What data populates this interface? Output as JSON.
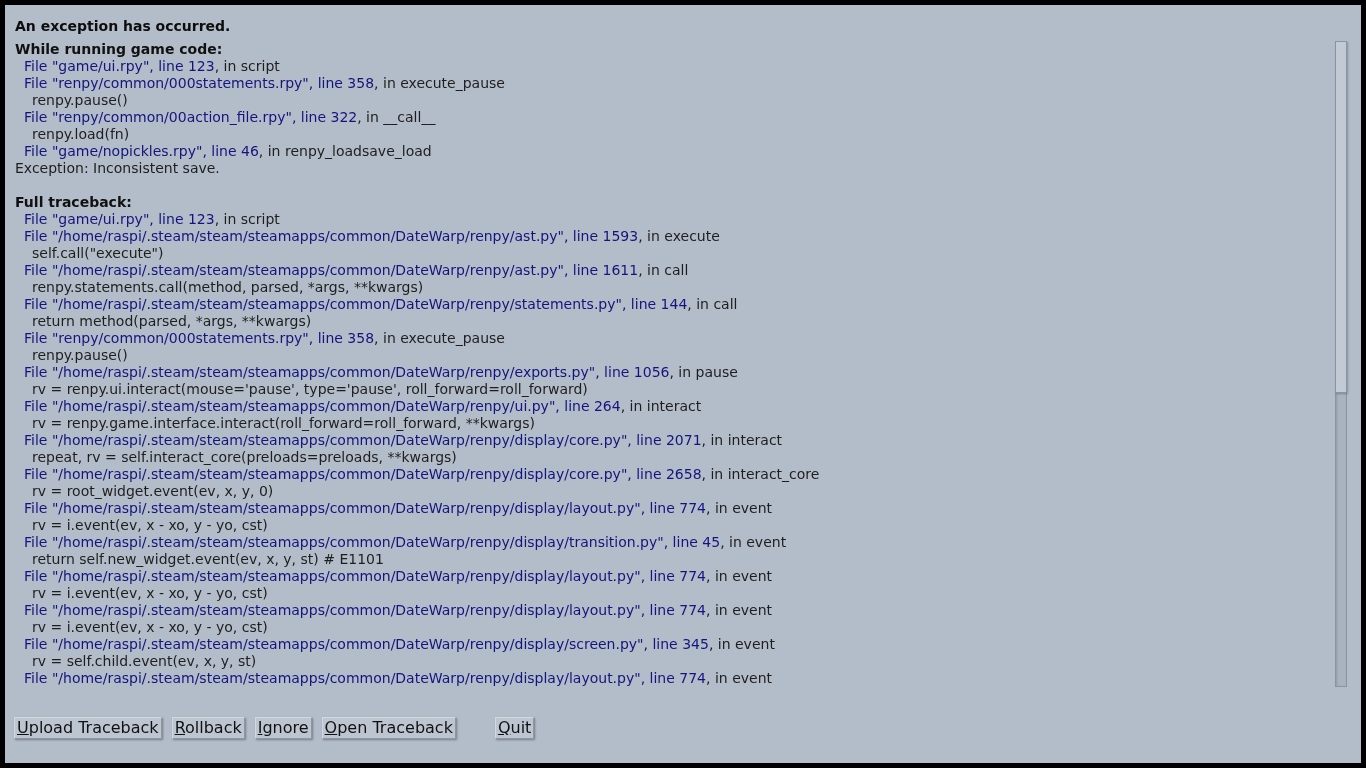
{
  "title": "An exception has occurred.",
  "sections": [
    {
      "heading": "While running game code:",
      "entries": [
        {
          "kind": "frame",
          "link": "File \"game/ui.rpy\", line 123",
          "detail": ", in script"
        },
        {
          "kind": "frame",
          "link": "File \"renpy/common/000statements.rpy\", line 358",
          "detail": ", in execute_pause"
        },
        {
          "kind": "code",
          "text": "renpy.pause()"
        },
        {
          "kind": "frame",
          "link": "File \"renpy/common/00action_file.rpy\", line 322",
          "detail": ", in __call__"
        },
        {
          "kind": "code",
          "text": "renpy.load(fn)"
        },
        {
          "kind": "frame",
          "link": "File \"game/nopickles.rpy\", line 46",
          "detail": ", in renpy_loadsave_load"
        },
        {
          "kind": "message",
          "text": "Exception: Inconsistent save."
        }
      ]
    },
    {
      "heading": "Full traceback:",
      "entries": [
        {
          "kind": "frame",
          "link": "File \"game/ui.rpy\", line 123",
          "detail": ", in script"
        },
        {
          "kind": "frame",
          "link": "File \"/home/raspi/.steam/steam/steamapps/common/DateWarp/renpy/ast.py\", line 1593",
          "detail": ", in execute"
        },
        {
          "kind": "code",
          "text": "self.call(\"execute\")"
        },
        {
          "kind": "frame",
          "link": "File \"/home/raspi/.steam/steam/steamapps/common/DateWarp/renpy/ast.py\", line 1611",
          "detail": ", in call"
        },
        {
          "kind": "code",
          "text": "renpy.statements.call(method, parsed, *args, **kwargs)"
        },
        {
          "kind": "frame",
          "link": "File \"/home/raspi/.steam/steam/steamapps/common/DateWarp/renpy/statements.py\", line 144",
          "detail": ", in call"
        },
        {
          "kind": "code",
          "text": "return method(parsed, *args, **kwargs)"
        },
        {
          "kind": "frame",
          "link": "File \"renpy/common/000statements.rpy\", line 358",
          "detail": ", in execute_pause"
        },
        {
          "kind": "code",
          "text": "renpy.pause()"
        },
        {
          "kind": "frame",
          "link": "File \"/home/raspi/.steam/steam/steamapps/common/DateWarp/renpy/exports.py\", line 1056",
          "detail": ", in pause"
        },
        {
          "kind": "code",
          "text": "rv = renpy.ui.interact(mouse='pause', type='pause', roll_forward=roll_forward)"
        },
        {
          "kind": "frame",
          "link": "File \"/home/raspi/.steam/steam/steamapps/common/DateWarp/renpy/ui.py\", line 264",
          "detail": ", in interact"
        },
        {
          "kind": "code",
          "text": "rv = renpy.game.interface.interact(roll_forward=roll_forward, **kwargs)"
        },
        {
          "kind": "frame",
          "link": "File \"/home/raspi/.steam/steam/steamapps/common/DateWarp/renpy/display/core.py\", line 2071",
          "detail": ", in interact"
        },
        {
          "kind": "code",
          "text": "repeat, rv = self.interact_core(preloads=preloads, **kwargs)"
        },
        {
          "kind": "frame",
          "link": "File \"/home/raspi/.steam/steam/steamapps/common/DateWarp/renpy/display/core.py\", line 2658",
          "detail": ", in interact_core"
        },
        {
          "kind": "code",
          "text": "rv = root_widget.event(ev, x, y, 0)"
        },
        {
          "kind": "frame",
          "link": "File \"/home/raspi/.steam/steam/steamapps/common/DateWarp/renpy/display/layout.py\", line 774",
          "detail": ", in event"
        },
        {
          "kind": "code",
          "text": "rv = i.event(ev, x - xo, y - yo, cst)"
        },
        {
          "kind": "frame",
          "link": "File \"/home/raspi/.steam/steam/steamapps/common/DateWarp/renpy/display/transition.py\", line 45",
          "detail": ", in event"
        },
        {
          "kind": "code",
          "text": "return self.new_widget.event(ev, x, y, st) # E1101"
        },
        {
          "kind": "frame",
          "link": "File \"/home/raspi/.steam/steam/steamapps/common/DateWarp/renpy/display/layout.py\", line 774",
          "detail": ", in event"
        },
        {
          "kind": "code",
          "text": "rv = i.event(ev, x - xo, y - yo, cst)"
        },
        {
          "kind": "frame",
          "link": "File \"/home/raspi/.steam/steam/steamapps/common/DateWarp/renpy/display/layout.py\", line 774",
          "detail": ", in event"
        },
        {
          "kind": "code",
          "text": "rv = i.event(ev, x - xo, y - yo, cst)"
        },
        {
          "kind": "frame",
          "link": "File \"/home/raspi/.steam/steam/steamapps/common/DateWarp/renpy/display/screen.py\", line 345",
          "detail": ", in event"
        },
        {
          "kind": "code",
          "text": "rv = self.child.event(ev, x, y, st)"
        },
        {
          "kind": "frame",
          "link": "File \"/home/raspi/.steam/steam/steamapps/common/DateWarp/renpy/display/layout.py\", line 774",
          "detail": ", in event"
        }
      ]
    }
  ],
  "buttons": [
    {
      "label": "Upload Traceback"
    },
    {
      "label": "Rollback"
    },
    {
      "label": "Ignore"
    },
    {
      "label": "Open Traceback"
    },
    {
      "label": "Quit"
    }
  ]
}
